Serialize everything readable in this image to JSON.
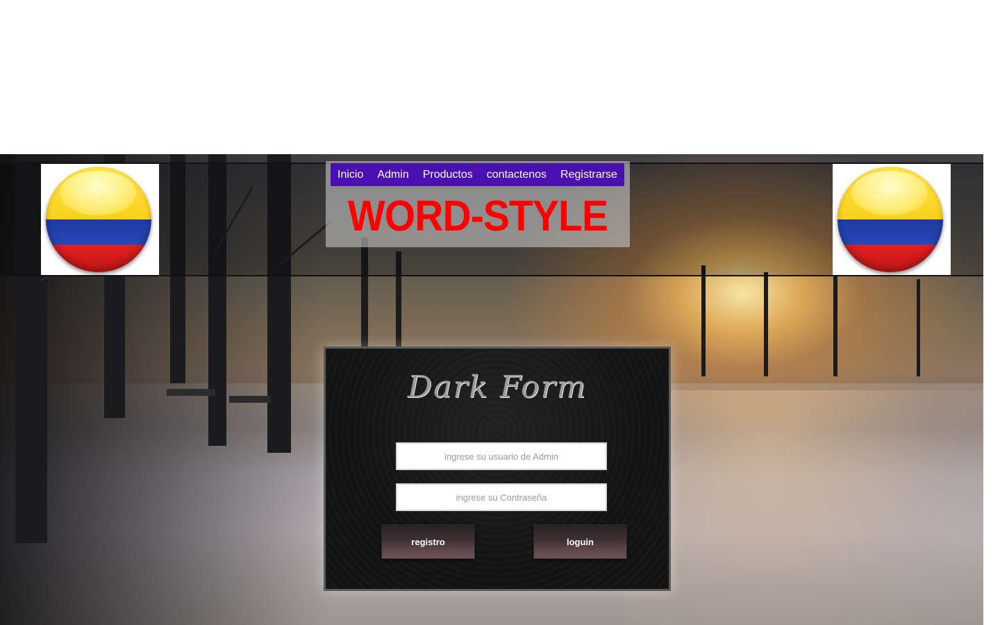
{
  "nav": {
    "items": [
      {
        "label": "Inicio"
      },
      {
        "label": "Admin"
      },
      {
        "label": "Productos"
      },
      {
        "label": "contactenos"
      },
      {
        "label": "Registrarse"
      }
    ]
  },
  "brand": {
    "title": "WORD-STYLE",
    "title_color": "#ff0000",
    "nav_color": "#4a0fb0"
  },
  "flags": {
    "left_icon": "colombia-flag-icon",
    "right_icon": "colombia-flag-icon"
  },
  "form": {
    "title": "Dark Form",
    "username_placeholder": "ingrese su usuario de Admin",
    "username_value": "",
    "password_placeholder": "ingrese su Contraseña",
    "password_value": "",
    "register_label": "registro",
    "login_label": "loguin"
  }
}
